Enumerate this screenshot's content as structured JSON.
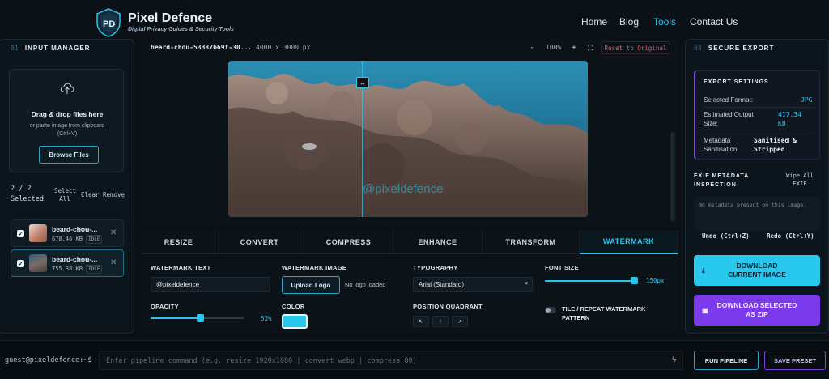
{
  "header": {
    "brand_name": "Pixel Defence",
    "brand_tagline": "Digital Privacy Guides & Security Tools",
    "nav": [
      {
        "label": "Home",
        "active": false
      },
      {
        "label": "Blog",
        "active": false
      },
      {
        "label": "Tools",
        "active": true
      },
      {
        "label": "Contact Us",
        "active": false
      }
    ]
  },
  "colors": {
    "accent": "#27c7ee",
    "purple": "#7c3aed",
    "background": "#0a1016"
  },
  "input_manager": {
    "num": "01",
    "title": "INPUT MANAGER",
    "drop_title": "Drag & drop files here",
    "drop_sub": "or paste image from clipboard (Ctrl+V)",
    "browse_label": "Browse Files",
    "selection": "2 / 2 Selected",
    "select_all": "Select All",
    "clear": "Clear",
    "remove": "Remove",
    "files": [
      {
        "name": "beard-chou-...",
        "size": "678.46 KB",
        "status": "IDLE",
        "checked": true
      },
      {
        "name": "beard-chou-...",
        "size": "755.38 KB",
        "status": "IDLE",
        "checked": true
      }
    ]
  },
  "preview": {
    "filename": "beard-chou-53387b69f-30...",
    "dimensions": "4000 x 3000 px",
    "zoom_minus": "-",
    "zoom": "100%",
    "zoom_plus": "+",
    "fit": "⛶",
    "reset_label": "Reset to Original",
    "watermark_text": "@pixeldefence",
    "compare_handle": "↔"
  },
  "tabs": [
    {
      "label": "RESIZE",
      "active": false
    },
    {
      "label": "CONVERT",
      "active": false
    },
    {
      "label": "COMPRESS",
      "active": false
    },
    {
      "label": "ENHANCE",
      "active": false
    },
    {
      "label": "TRANSFORM",
      "active": false
    },
    {
      "label": "WATERMARK",
      "active": true
    }
  ],
  "watermark": {
    "text_label": "WATERMARK TEXT",
    "text_value": "@pixeldefence",
    "image_label": "WATERMARK IMAGE",
    "upload_label": "Upload Logo",
    "no_logo": "No logo loaded",
    "typography_label": "TYPOGRAPHY",
    "typography_value": "Arial (Standard)",
    "font_size_label": "FONT SIZE",
    "font_size_value": "150px",
    "font_size_fraction": 0.96,
    "opacity_label": "OPACITY",
    "opacity_value": "53%",
    "opacity_fraction": 0.53,
    "color_label": "COLOR",
    "color_value": "#27c7ee",
    "position_label": "POSITION QUADRANT",
    "quadrants": [
      "↖",
      "↑",
      "↗"
    ],
    "tile_label": "TILE / REPEAT WATERMARK PATTERN"
  },
  "secure_export": {
    "num": "03",
    "title": "SECURE EXPORT",
    "settings_title": "EXPORT SETTINGS",
    "format_key": "Selected Format:",
    "format_value": "JPG",
    "size_key": "Estimated Output Size:",
    "size_value": "417.34 KB",
    "meta_key": "Metadata Sanitisation:",
    "meta_value": "Sanitised & Stripped",
    "exif_title": "EXIF METADATA INSPECTION",
    "wipe_label": "Wipe All EXIF",
    "exif_empty": "No metadata present on this image.",
    "undo_label": "Undo (Ctrl+Z)",
    "redo_label": "Redo (Ctrl+Y)",
    "download_current": "DOWNLOAD CURRENT IMAGE",
    "download_zip": "DOWNLOAD SELECTED AS ZIP"
  },
  "terminal": {
    "prompt": "guest@pixeldefence:~$",
    "placeholder": "Enter pipeline command (e.g. resize 1920x1080 | convert webp | compress 80)",
    "run_label": "RUN PIPELINE",
    "save_label": "SAVE PRESET"
  }
}
